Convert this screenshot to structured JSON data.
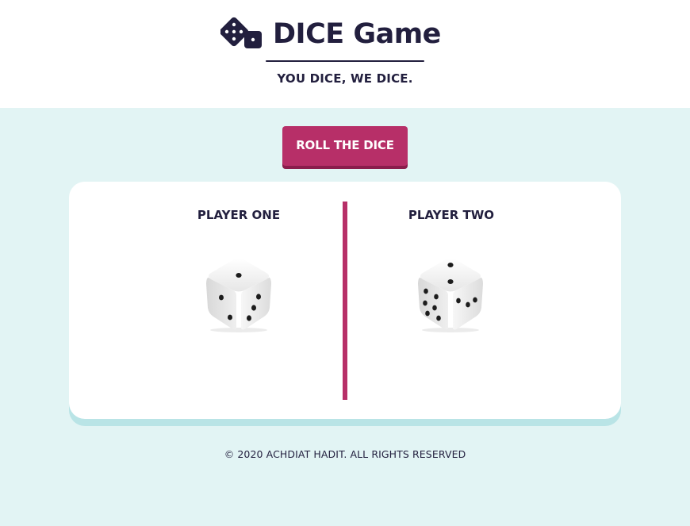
{
  "header": {
    "logo_icon": "dice-icon",
    "title": "DICE Game",
    "tagline": "YOU DICE, WE DICE."
  },
  "roll_button": {
    "label": "ROLL THE DICE"
  },
  "players": [
    {
      "label": "PLAYER ONE",
      "die_value": 3,
      "die_icon": "die-face-3-icon"
    },
    {
      "label": "PLAYER TWO",
      "die_value": 6,
      "die_icon": "die-face-6-icon"
    }
  ],
  "footer": {
    "copyright": "© 2020 ACHDIAT HADIT. ALL RIGHTS RESERVED"
  },
  "colors": {
    "primary": "#221f3e",
    "accent": "#b72f68",
    "background": "#e2f4f4",
    "card": "#ffffff"
  }
}
